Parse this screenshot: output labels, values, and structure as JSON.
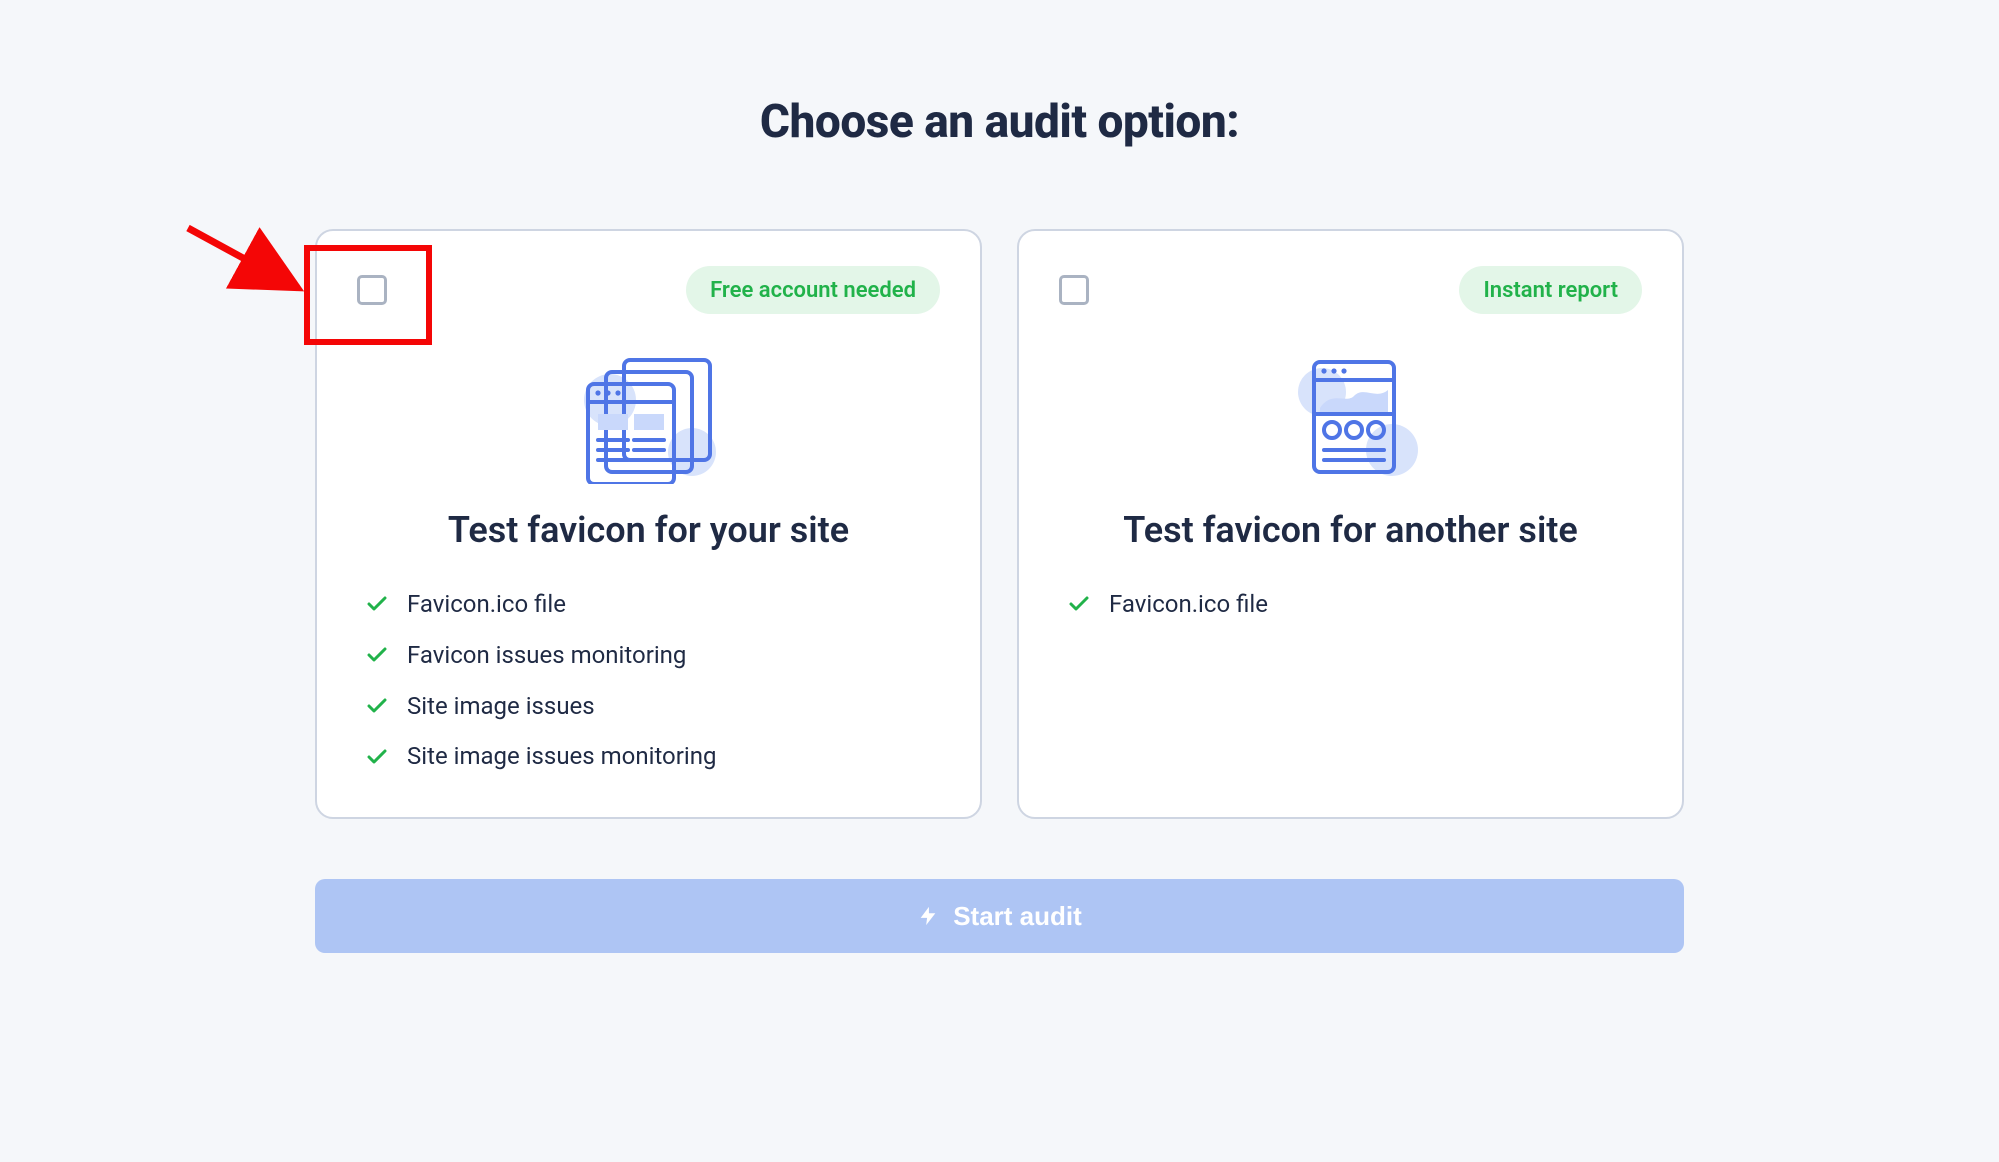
{
  "title": "Choose an audit option:",
  "cards": {
    "your_site": {
      "badge": "Free account needed",
      "title": "Test favicon for your site",
      "features": [
        "Favicon.ico file",
        "Favicon issues monitoring",
        "Site image issues",
        "Site image issues monitoring"
      ]
    },
    "another_site": {
      "badge": "Instant report",
      "title": "Test favicon for another site",
      "features": [
        "Favicon.ico file"
      ]
    }
  },
  "action": {
    "label": "Start audit"
  }
}
